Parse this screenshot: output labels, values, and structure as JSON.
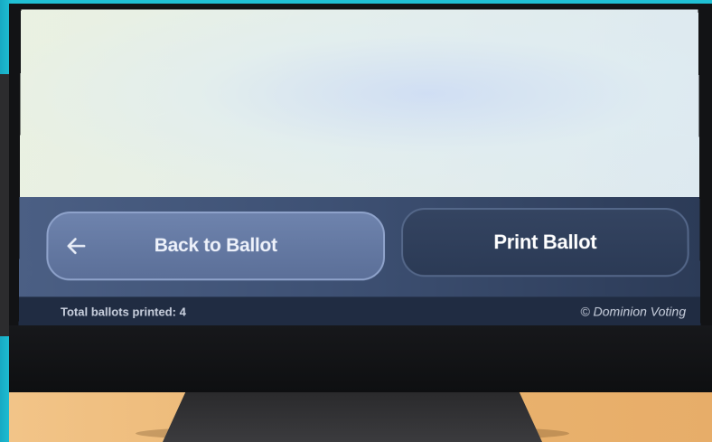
{
  "buttons": {
    "back_label": "Back to Ballot",
    "print_label": "Print Ballot"
  },
  "status": {
    "total_printed": "Total ballots printed: 4",
    "copyright": "© Dominion Voting"
  },
  "icons": {
    "back": "arrow-left-icon"
  },
  "colors": {
    "action_bar": "#3e5174",
    "back_button": "#6e83ad",
    "print_button": "#344461",
    "status_bar": "#202c42",
    "text": "#ffffff"
  }
}
